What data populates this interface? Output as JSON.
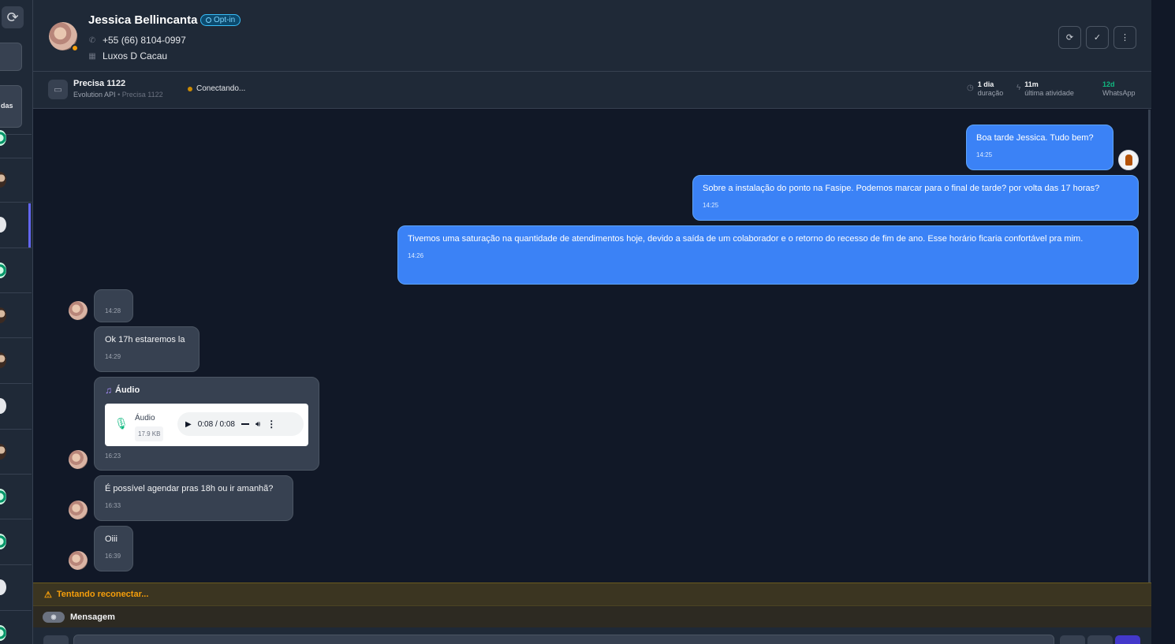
{
  "contact": {
    "name": "Jessica Bellincanta",
    "badge": "Opt-in",
    "phone": "+55 (66) 8104-0997",
    "company": "Luxos D Cacau"
  },
  "sidebar": {
    "filter_label": "das"
  },
  "session": {
    "name": "Precisa 1122",
    "provider": "Evolution API",
    "separator": "•",
    "instance": "Precisa 1122",
    "status": "Conectando...",
    "stats": [
      {
        "value": "1 dia",
        "label": "duração",
        "icon": "clock-icon"
      },
      {
        "value": "11m",
        "label": "última atividade",
        "icon": "bolt-icon"
      },
      {
        "value": "12d",
        "label": "WhatsApp",
        "icon": ""
      }
    ]
  },
  "messages": {
    "out": [
      {
        "text": "Boa tarde Jessica. Tudo bem?",
        "time": "14:25"
      },
      {
        "text": "Sobre a instalação do ponto na Fasipe. Podemos marcar para o final de tarde? por volta das 17 horas?",
        "time": "14:25"
      },
      {
        "text": "Tivemos uma saturação na quantidade de atendimentos hoje, devido a saída de um colaborador e o retorno do recesso de fim de ano. Esse horário ficaria confortável pra mim.",
        "time": "14:26"
      }
    ],
    "in": [
      {
        "text": "",
        "time": "14:28"
      },
      {
        "text": "Ok 17h estaremos la",
        "time": "14:29"
      },
      {
        "text": "É possível agendar pras 18h ou ir amanhã?",
        "time": "16:33"
      },
      {
        "text": "Oiii",
        "time": "16:39"
      }
    ],
    "audio": {
      "title": "Áudio",
      "label": "Áudio",
      "size": "17.9 KB",
      "player_time": "0:08 / 0:08",
      "time": "16:23"
    }
  },
  "alerts": {
    "reconnect": "Tentando reconectar..."
  },
  "composer": {
    "mode_label": "Mensagem"
  },
  "colors": {
    "accent": "#3b82f6",
    "warning": "#f59e0b",
    "success": "#10b981",
    "bg": "#111827"
  }
}
